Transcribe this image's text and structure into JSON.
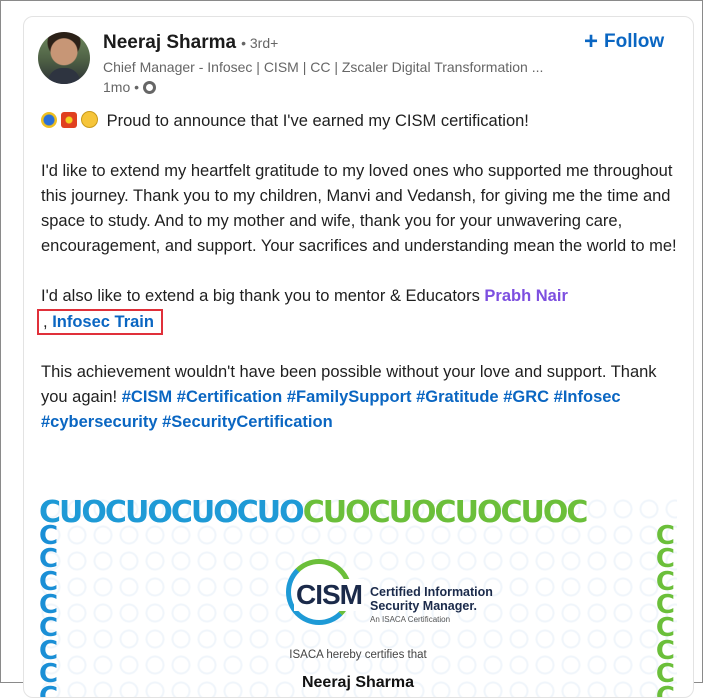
{
  "post": {
    "author_name": "Neeraj Sharma",
    "degree": "• 3rd+",
    "headline": "Chief Manager - Infosec | CISM | CC | Zscaler Digital Transformation ...",
    "time": "1mo •",
    "follow_label": "Follow",
    "intro": "Proud to announce that I've earned my CISM certification!",
    "gratitude": "I'd like to extend my heartfelt gratitude to my loved ones who supported me throughout this journey. Thank you to my children, Manvi and Vedansh, for giving me the time and space to study. And to my mother and wife, thank you for your unwavering care, encouragement, and support. Your sacrifices and understanding mean the world to me!",
    "mentors_prefix": "I'd also like to extend a big thank you to mentor & Educators",
    "mention_person": "Prabh Nair",
    "mention_separator": ",",
    "mention_company": "Infosec Train",
    "closing": "This achievement wouldn't have been possible without your love and support. Thank you again!",
    "hashtags": [
      "#CISM",
      "#Certification",
      "#FamilySupport",
      "#Gratitude",
      "#GRC",
      "#Infosec",
      "#cybersecurity",
      "#SecurityCertification"
    ]
  },
  "certificate": {
    "logo_text": "CISM",
    "title_line1": "Certified Information",
    "title_line2": "Security Manager.",
    "subtitle": "An ISACA Certification",
    "hereby": "ISACA hereby certifies that",
    "recipient": "Neeraj Sharma",
    "border_top": "CUOCUOCUOCUOCUOCUOCUOCUOC",
    "border_side": "CCCCCCCC"
  },
  "colors": {
    "link_blue": "#0a66c2",
    "mention_purple": "#7d4fe0",
    "highlight_red": "#e0303a"
  },
  "icons": [
    "globe-icon",
    "plus-icon",
    "emoji-rocket",
    "emoji-collision",
    "emoji-smile"
  ]
}
